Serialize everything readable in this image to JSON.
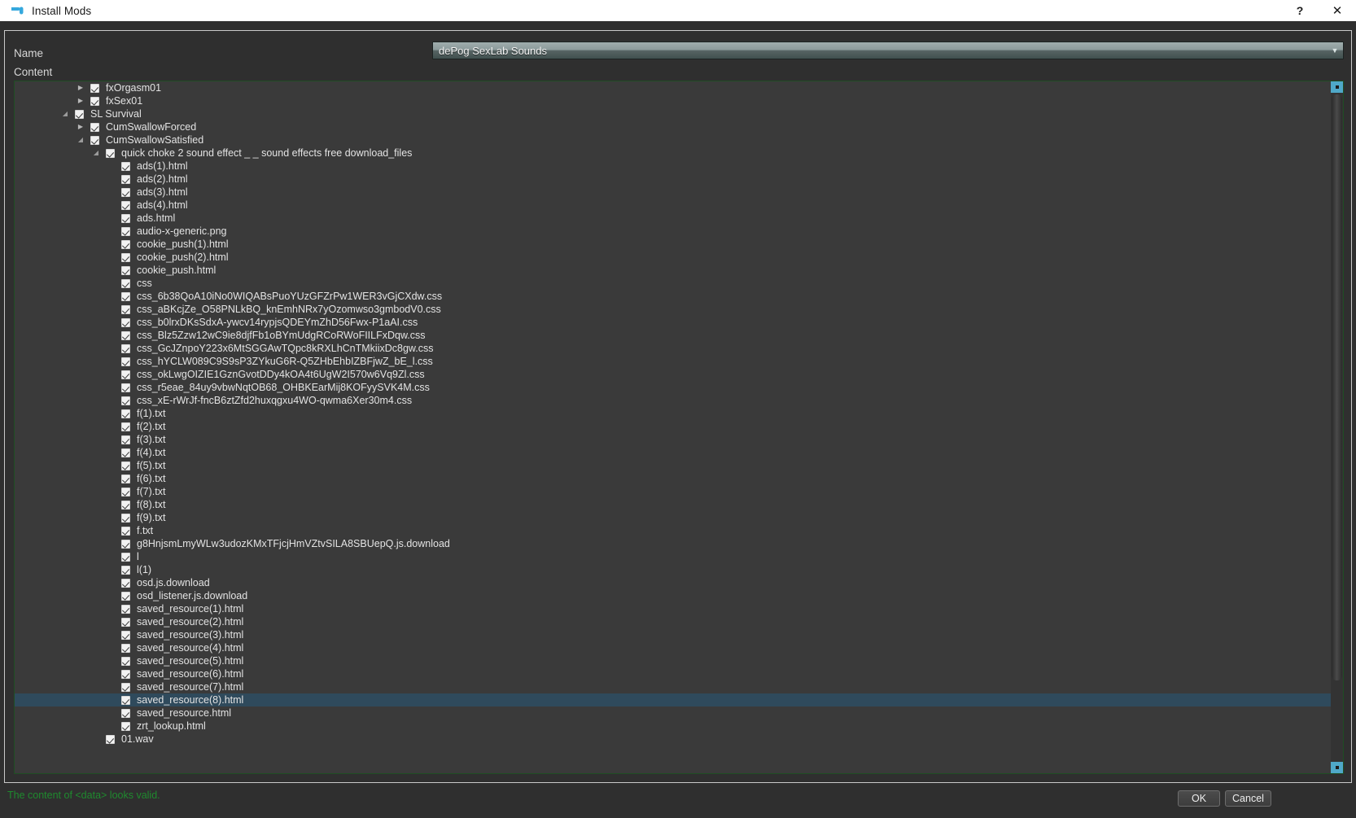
{
  "window": {
    "title": "Install Mods",
    "icon": "mod-window-icon",
    "help_label": "?",
    "close_label": "✕"
  },
  "form": {
    "name_label": "Name",
    "content_label": "Content",
    "name_value": "dePog SexLab Sounds",
    "name_arrow": "▼"
  },
  "footer": {
    "status": "The content of <data> looks valid.",
    "status_color": "#1f8a2e",
    "ok_label": "OK",
    "cancel_label": "Cancel"
  },
  "scrollbar": {
    "up_label": "scroll-up",
    "down_label": "scroll-down"
  },
  "tree": [
    {
      "indent": 1,
      "twisty": "closed",
      "checked": true,
      "label": "fxOrgasm01"
    },
    {
      "indent": 1,
      "twisty": "closed",
      "checked": true,
      "label": "fxSex01"
    },
    {
      "indent": 0,
      "twisty": "open",
      "checked": true,
      "label": "SL Survival"
    },
    {
      "indent": 1,
      "twisty": "closed",
      "checked": true,
      "label": "CumSwallowForced"
    },
    {
      "indent": 1,
      "twisty": "open",
      "checked": true,
      "label": "CumSwallowSatisfied"
    },
    {
      "indent": 2,
      "twisty": "open",
      "checked": true,
      "label": "quick choke 2 sound effect _ _ sound effects free download_files"
    },
    {
      "indent": 3,
      "twisty": "none",
      "checked": true,
      "label": "ads(1).html"
    },
    {
      "indent": 3,
      "twisty": "none",
      "checked": true,
      "label": "ads(2).html"
    },
    {
      "indent": 3,
      "twisty": "none",
      "checked": true,
      "label": "ads(3).html"
    },
    {
      "indent": 3,
      "twisty": "none",
      "checked": true,
      "label": "ads(4).html"
    },
    {
      "indent": 3,
      "twisty": "none",
      "checked": true,
      "label": "ads.html"
    },
    {
      "indent": 3,
      "twisty": "none",
      "checked": true,
      "label": "audio-x-generic.png"
    },
    {
      "indent": 3,
      "twisty": "none",
      "checked": true,
      "label": "cookie_push(1).html"
    },
    {
      "indent": 3,
      "twisty": "none",
      "checked": true,
      "label": "cookie_push(2).html"
    },
    {
      "indent": 3,
      "twisty": "none",
      "checked": true,
      "label": "cookie_push.html"
    },
    {
      "indent": 3,
      "twisty": "none",
      "checked": true,
      "label": "css"
    },
    {
      "indent": 3,
      "twisty": "none",
      "checked": true,
      "label": "css_6b38QoA10iNo0WIQABsPuoYUzGFZrPw1WER3vGjCXdw.css"
    },
    {
      "indent": 3,
      "twisty": "none",
      "checked": true,
      "label": "css_aBKcjZe_O58PNLkBQ_knEmhNRx7yOzomwso3gmbodV0.css"
    },
    {
      "indent": 3,
      "twisty": "none",
      "checked": true,
      "label": "css_b0lrxDKsSdxA-ywcv14rypjsQDEYmZhD56Fwx-P1aAI.css"
    },
    {
      "indent": 3,
      "twisty": "none",
      "checked": true,
      "label": "css_Blz5Zzw12wC9ie8djfFb1oBYmUdgRCoRWoFIILFxDqw.css"
    },
    {
      "indent": 3,
      "twisty": "none",
      "checked": true,
      "label": "css_GcJZnpoY223x6MtSGGAwTQpc8kRXLhCnTMkiixDc8gw.css"
    },
    {
      "indent": 3,
      "twisty": "none",
      "checked": true,
      "label": "css_hYCLW089C9S9sP3ZYkuG6R-Q5ZHbEhbIZBFjwZ_bE_l.css"
    },
    {
      "indent": 3,
      "twisty": "none",
      "checked": true,
      "label": "css_okLwgOIZIE1GznGvotDDy4kOA4t6UgW2I570w6Vq9Zl.css"
    },
    {
      "indent": 3,
      "twisty": "none",
      "checked": true,
      "label": "css_r5eae_84uy9vbwNqtOB68_OHBKEarMij8KOFyySVK4M.css"
    },
    {
      "indent": 3,
      "twisty": "none",
      "checked": true,
      "label": "css_xE-rWrJf-fncB6ztZfd2huxqgxu4WO-qwma6Xer30m4.css"
    },
    {
      "indent": 3,
      "twisty": "none",
      "checked": true,
      "label": "f(1).txt"
    },
    {
      "indent": 3,
      "twisty": "none",
      "checked": true,
      "label": "f(2).txt"
    },
    {
      "indent": 3,
      "twisty": "none",
      "checked": true,
      "label": "f(3).txt"
    },
    {
      "indent": 3,
      "twisty": "none",
      "checked": true,
      "label": "f(4).txt"
    },
    {
      "indent": 3,
      "twisty": "none",
      "checked": true,
      "label": "f(5).txt"
    },
    {
      "indent": 3,
      "twisty": "none",
      "checked": true,
      "label": "f(6).txt"
    },
    {
      "indent": 3,
      "twisty": "none",
      "checked": true,
      "label": "f(7).txt"
    },
    {
      "indent": 3,
      "twisty": "none",
      "checked": true,
      "label": "f(8).txt"
    },
    {
      "indent": 3,
      "twisty": "none",
      "checked": true,
      "label": "f(9).txt"
    },
    {
      "indent": 3,
      "twisty": "none",
      "checked": true,
      "label": "f.txt"
    },
    {
      "indent": 3,
      "twisty": "none",
      "checked": true,
      "label": "g8HnjsmLmyWLw3udozKMxTFjcjHmVZtvSILA8SBUepQ.js.download"
    },
    {
      "indent": 3,
      "twisty": "none",
      "checked": true,
      "label": "l"
    },
    {
      "indent": 3,
      "twisty": "none",
      "checked": true,
      "label": "l(1)"
    },
    {
      "indent": 3,
      "twisty": "none",
      "checked": true,
      "label": "osd.js.download"
    },
    {
      "indent": 3,
      "twisty": "none",
      "checked": true,
      "label": "osd_listener.js.download"
    },
    {
      "indent": 3,
      "twisty": "none",
      "checked": true,
      "label": "saved_resource(1).html"
    },
    {
      "indent": 3,
      "twisty": "none",
      "checked": true,
      "label": "saved_resource(2).html"
    },
    {
      "indent": 3,
      "twisty": "none",
      "checked": true,
      "label": "saved_resource(3).html"
    },
    {
      "indent": 3,
      "twisty": "none",
      "checked": true,
      "label": "saved_resource(4).html"
    },
    {
      "indent": 3,
      "twisty": "none",
      "checked": true,
      "label": "saved_resource(5).html"
    },
    {
      "indent": 3,
      "twisty": "none",
      "checked": true,
      "label": "saved_resource(6).html"
    },
    {
      "indent": 3,
      "twisty": "none",
      "checked": true,
      "label": "saved_resource(7).html"
    },
    {
      "indent": 3,
      "twisty": "none",
      "checked": true,
      "label": "saved_resource(8).html",
      "selected": true
    },
    {
      "indent": 3,
      "twisty": "none",
      "checked": true,
      "label": "saved_resource.html"
    },
    {
      "indent": 3,
      "twisty": "none",
      "checked": true,
      "label": "zrt_lookup.html"
    },
    {
      "indent": 2,
      "twisty": "none",
      "checked": true,
      "label": "01.wav"
    }
  ]
}
